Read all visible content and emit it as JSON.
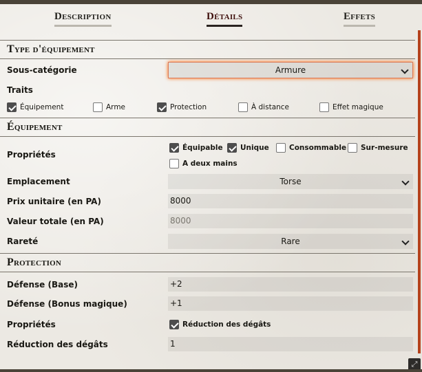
{
  "tabs": [
    {
      "label": "Description"
    },
    {
      "label": "Détails"
    },
    {
      "label": "Effets"
    }
  ],
  "equipment_type": {
    "title": "Type d'équipement",
    "subcategory_label": "Sous-catégorie",
    "subcategory_value": "Armure",
    "traits_label": "Traits",
    "traits": [
      {
        "label": "Équipement",
        "checked": true
      },
      {
        "label": "Arme",
        "checked": false
      },
      {
        "label": "Protection",
        "checked": true
      },
      {
        "label": "À distance",
        "checked": false
      },
      {
        "label": "Effet magique",
        "checked": false
      }
    ]
  },
  "equipment": {
    "title": "Équipement",
    "properties_label": "Propriétés",
    "properties": [
      {
        "label": "Équipable",
        "checked": true
      },
      {
        "label": "Unique",
        "checked": true
      },
      {
        "label": "Consommable",
        "checked": false
      },
      {
        "label": "Sur-mesure",
        "checked": false
      },
      {
        "label": "A deux mains",
        "checked": false
      }
    ],
    "slot_label": "Emplacement",
    "slot_value": "Torse",
    "unit_price_label": "Prix unitaire (en PA)",
    "unit_price_value": "8000",
    "total_value_label": "Valeur totale (en PA)",
    "total_value_value": "8000",
    "rarity_label": "Rareté",
    "rarity_value": "Rare"
  },
  "protection": {
    "title": "Protection",
    "defense_base_label": "Défense (Base)",
    "defense_base_value": "+2",
    "defense_bonus_label": "Défense (Bonus magique)",
    "defense_bonus_value": "+1",
    "properties_label": "Propriétés",
    "properties": [
      {
        "label": "Réduction des dégâts",
        "checked": true
      }
    ],
    "damage_reduction_label": "Réduction des dégâts",
    "damage_reduction_value": "1"
  },
  "colors": {
    "accent": "#b5421c",
    "focus_glow": "#ff6400",
    "checkbox_checked": "#4d4d4d"
  }
}
